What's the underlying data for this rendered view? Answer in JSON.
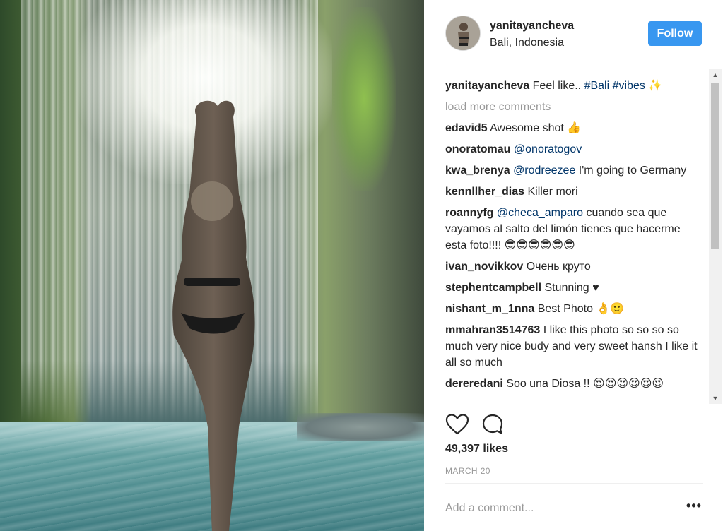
{
  "post": {
    "photo_description_icon": "waterfall-photo",
    "author": {
      "username": "yanitayancheva",
      "location": "Bali, Indonesia",
      "follow_label": "Follow"
    },
    "caption": {
      "username": "yanitayancheva",
      "text": "Feel like..",
      "hashtags": [
        "#Bali",
        "#vibes"
      ]
    },
    "load_more_label": "load more comments",
    "comments": [
      {
        "username": "edavid5",
        "text": "Awesome shot 👍"
      },
      {
        "username": "onoratomau",
        "mention": "@onoratogov",
        "text": ""
      },
      {
        "username": "kwa_brenya",
        "mention": "@rodreezee",
        "text": " I'm going to Germany"
      },
      {
        "username": "kennllher_dias",
        "text": "Killer mori"
      },
      {
        "username": "roannyfg",
        "mention": "@checa_amparo",
        "text": " cuando sea que vayamos al salto del limón tienes que hacerme esta foto!!!! 😎😎😎😎😎😎"
      },
      {
        "username": "ivan_novikkov",
        "text": "Очень круто"
      },
      {
        "username": "stephentcampbell",
        "text": "Stunning ♥"
      },
      {
        "username": "nishant_m_1nna",
        "text": "Best Photo 👌🙂"
      },
      {
        "username": "mmahran3514763",
        "text": "I like this photo so so so so much very nice budy and very sweet hansh I like it all so much"
      },
      {
        "username": "dereredani",
        "text": "Soo una Diosa !! 😍😍😍😍😍😍"
      }
    ],
    "likes": "49,397 likes",
    "date": "MARCH 20",
    "add_comment_placeholder": "Add a comment...",
    "more_label": "•••"
  },
  "colors": {
    "follow_button": "#3897f0",
    "mention": "#003569",
    "muted": "#999999"
  }
}
